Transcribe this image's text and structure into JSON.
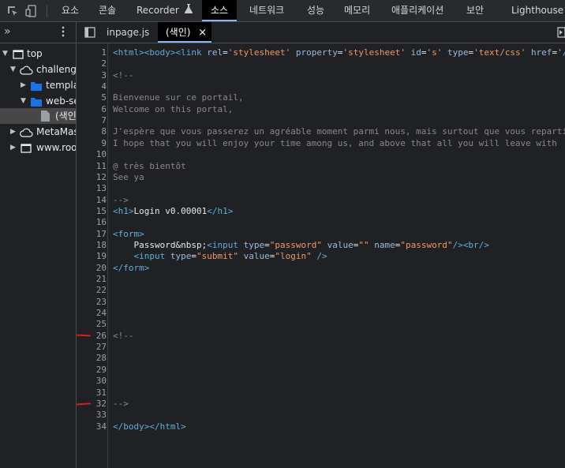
{
  "toolbar": {
    "tabs": [
      "요소",
      "콘솔",
      "Recorder",
      "소스",
      "네트워크",
      "성능",
      "메모리",
      "애플리케이션",
      "보안",
      "Lighthouse"
    ],
    "active_tab": "소스"
  },
  "navigator": {
    "items": [
      {
        "label": "top"
      },
      {
        "label": "challenge"
      },
      {
        "label": "templat"
      },
      {
        "label": "web-se"
      },
      {
        "label": "(색인"
      },
      {
        "label": "MetaMask"
      },
      {
        "label": "www.root"
      }
    ]
  },
  "file_tabs": [
    {
      "label": "inpage.js"
    },
    {
      "label": "(색인)",
      "close": "×"
    }
  ],
  "editor": {
    "line_numbers": [
      "1",
      "2",
      "3",
      "4",
      "5",
      "6",
      "7",
      "8",
      "9",
      "10",
      "11",
      "12",
      "13",
      "14",
      "15",
      "16",
      "17",
      "18",
      "19",
      "20",
      "21",
      "22",
      "23",
      "24",
      "25",
      "26",
      "27",
      "28",
      "29",
      "30",
      "31",
      "32",
      "33",
      "34"
    ],
    "lines": [
      "<html><body><link rel='stylesheet' property='stylesheet' id='s' type='text/css' href='/",
      "",
      "<!--",
      "",
      "Bienvenue sur ce portail,",
      "Welcome on this portal,",
      "",
      "J'espère que vous passerez un agréable moment parmi nous, mais surtout que vous reparti",
      "I hope that you will enjoy your time among us, and above that all you will leave with ",
      "",
      "@ très bientôt",
      "See ya",
      "",
      "-->",
      "<h1>Login v0.00001</h1>",
      "",
      "<form>",
      "    Password&nbsp;<input type=\"password\" value=\"\" name=\"password\"/><br/>",
      "    <input type=\"submit\" value=\"login\" />",
      "</form>",
      "",
      "",
      "",
      "",
      "",
      "<!--",
      "",
      "",
      "",
      "",
      "",
      "-->",
      "",
      "</body></html>"
    ]
  }
}
